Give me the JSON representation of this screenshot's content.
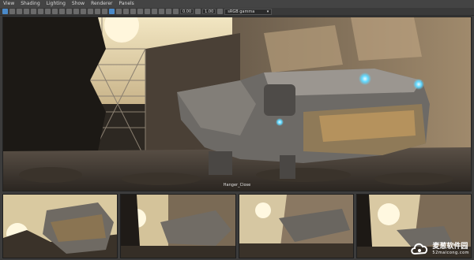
{
  "menu": [
    "View",
    "Shading",
    "Lighting",
    "Show",
    "Renderer",
    "Panels"
  ],
  "toolbar": {
    "field1": "0.00",
    "field2": "1.00",
    "color_space": "sRGB gamma"
  },
  "viewport": {
    "camera_label": "Hanger_Close"
  },
  "watermark": {
    "name": "麦葱软件园",
    "url": "52maicong.com"
  }
}
